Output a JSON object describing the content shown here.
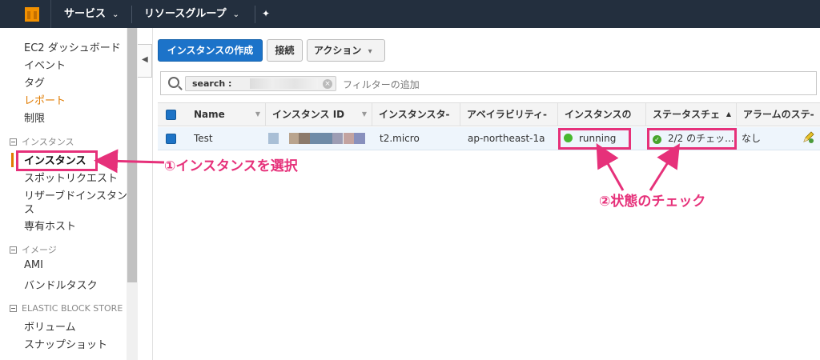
{
  "topbar": {
    "services": "サービス",
    "resource_groups": "リソースグループ",
    "pin": "✦"
  },
  "sidebar": {
    "items_top": [
      "EC2 ダッシュボード",
      "イベント",
      "タグ",
      "レポート",
      "制限"
    ],
    "section_instances": "インスタンス",
    "instances_items": [
      "インスタンス",
      "スポットリクエスト",
      "リザーブドインスタン",
      "ス",
      "専有ホスト"
    ],
    "section_images": "イメージ",
    "images_items": [
      "AMI",
      "バンドルタスク"
    ],
    "section_ebs": "ELASTIC BLOCK STORE",
    "ebs_items": [
      "ボリューム",
      "スナップショット"
    ]
  },
  "toolbar": {
    "create": "インスタンスの作成",
    "connect": "接続",
    "action": "アクション"
  },
  "filter": {
    "token_key": "search :",
    "placeholder": "フィルターの追加"
  },
  "table": {
    "headers": [
      "Name",
      "インスタンス ID",
      "インスタンスタ-",
      "アベイラビリティ-",
      "インスタンスの",
      "ステータスチェ",
      "アラームのステ-"
    ],
    "row": {
      "name": "Test",
      "type": "t2.micro",
      "az": "ap-northeast-1a",
      "state": "running",
      "status": "2/2 のチェッ...",
      "alarm": "なし"
    }
  },
  "annotations": {
    "select": "①インスタンスを選択",
    "check": "②状態のチェック"
  },
  "colors": {
    "accent": "#e6317a",
    "primary": "#1c73c9",
    "running": "#47b82f"
  }
}
